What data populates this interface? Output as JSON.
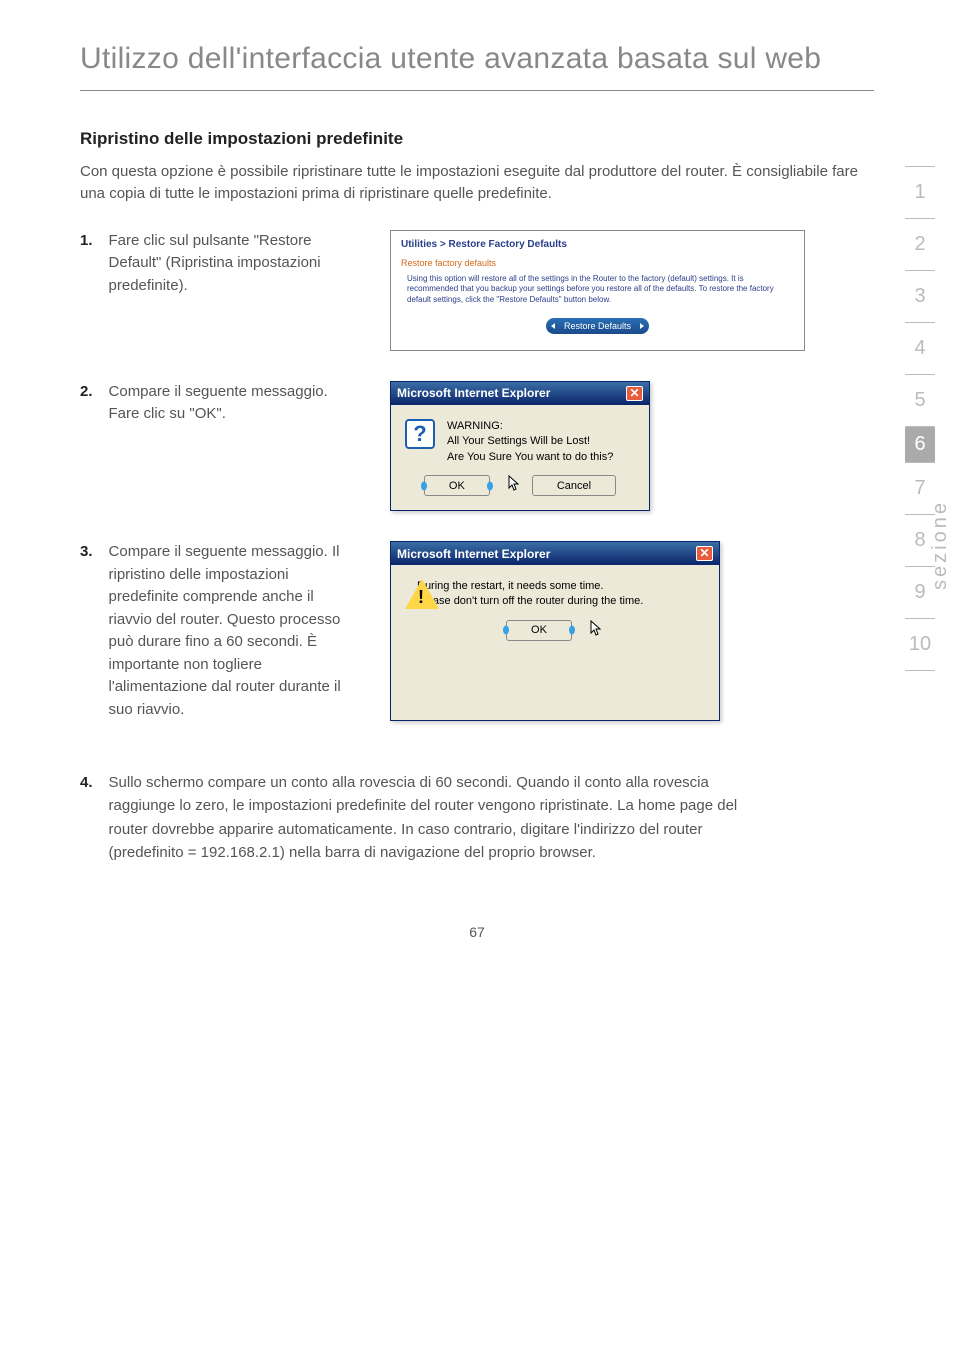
{
  "title": "Utilizzo dell'interfaccia utente avanzata basata sul web",
  "section_heading": "Ripristino delle impostazioni predefinite",
  "intro": " Con questa opzione è possibile ripristinare tutte le impostazioni eseguite dal produttore del router. È consigliabile fare una copia di tutte le impostazioni prima di ripristinare quelle predefinite.",
  "steps": {
    "s1": {
      "num": "1.",
      "text": "Fare clic sul pulsante \"Restore Default\" (Ripristina impostazioni predefinite)."
    },
    "s2": {
      "num": "2.",
      "text": "Compare il seguente messaggio. Fare clic su \"OK\"."
    },
    "s3": {
      "num": "3.",
      "text": "Compare il seguente messaggio. Il ripristino delle impostazioni predefinite comprende anche il riavvio del router. Questo processo può durare fino a 60 secondi. È importante non togliere l'alimentazione dal router durante il suo riavvio."
    },
    "s4": {
      "num": "4.",
      "text": "Sullo schermo compare un conto alla rovescia di 60 secondi. Quando il conto alla rovescia raggiunge lo zero, le impostazioni predefinite del router vengono ripristinate. La home page del router dovrebbe apparire automaticamente. In caso contrario, digitare l'indirizzo del router (predefinito = 192.168.2.1) nella barra di navigazione del proprio browser."
    }
  },
  "util_panel": {
    "title": "Utilities > Restore Factory Defaults",
    "sub": "Restore factory defaults",
    "desc": "Using this option will restore all of the settings in the Router to the factory (default) settings. It is recommended that you backup your settings before you restore all of the defaults. To restore the factory default settings, click the \"Restore Defaults\" button below.",
    "button": "Restore Defaults"
  },
  "dialog1": {
    "title": "Microsoft Internet Explorer",
    "line1": "WARNING:",
    "line2": "All Your Settings Will be Lost!",
    "line3": "Are You Sure You want to do this?",
    "ok": "OK",
    "cancel": "Cancel"
  },
  "dialog2": {
    "title": "Microsoft Internet Explorer",
    "line1": "During the restart, it needs some time.",
    "line2": "Please don't turn off the router during the time.",
    "ok": "OK"
  },
  "sidenav": [
    "1",
    "2",
    "3",
    "4",
    "5",
    "6",
    "7",
    "8",
    "9",
    "10"
  ],
  "sidenav_active_index": 5,
  "vlabel": "sezione",
  "page_number": "67"
}
